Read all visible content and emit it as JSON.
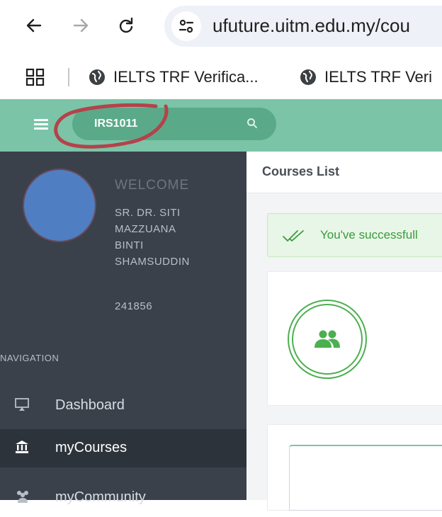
{
  "browser": {
    "url": "ufuture.uitm.edu.my/cou",
    "bookmarks": [
      {
        "label": "IELTS TRF Verifica...",
        "icon": "globe-icon"
      },
      {
        "label": "IELTS TRF Veri",
        "icon": "globe-icon"
      }
    ]
  },
  "header": {
    "search_value": "IRS1011"
  },
  "sidebar": {
    "welcome": "WELCOME",
    "user_name_lines": [
      "SR. DR. SITI",
      "MAZZUANA",
      "BINTI",
      "SHAMSUDDIN"
    ],
    "user_id": "241856",
    "navigation_heading": "NAVIGATION",
    "items": [
      {
        "label": "Dashboard",
        "icon": "monitor-icon",
        "active": false
      },
      {
        "label": "myCourses",
        "icon": "bank-icon",
        "active": true
      },
      {
        "label": "myCommunity",
        "icon": "users-icon",
        "active": false
      }
    ]
  },
  "main": {
    "title": "Courses List",
    "alert_text": "You've successfull",
    "card_icon": "users-icon"
  },
  "colors": {
    "header": "#7bc4a8",
    "sidebar": "#3a414b",
    "alert_bg": "#e7f6e6",
    "success": "#4caf50",
    "annotation": "#b5424a"
  }
}
